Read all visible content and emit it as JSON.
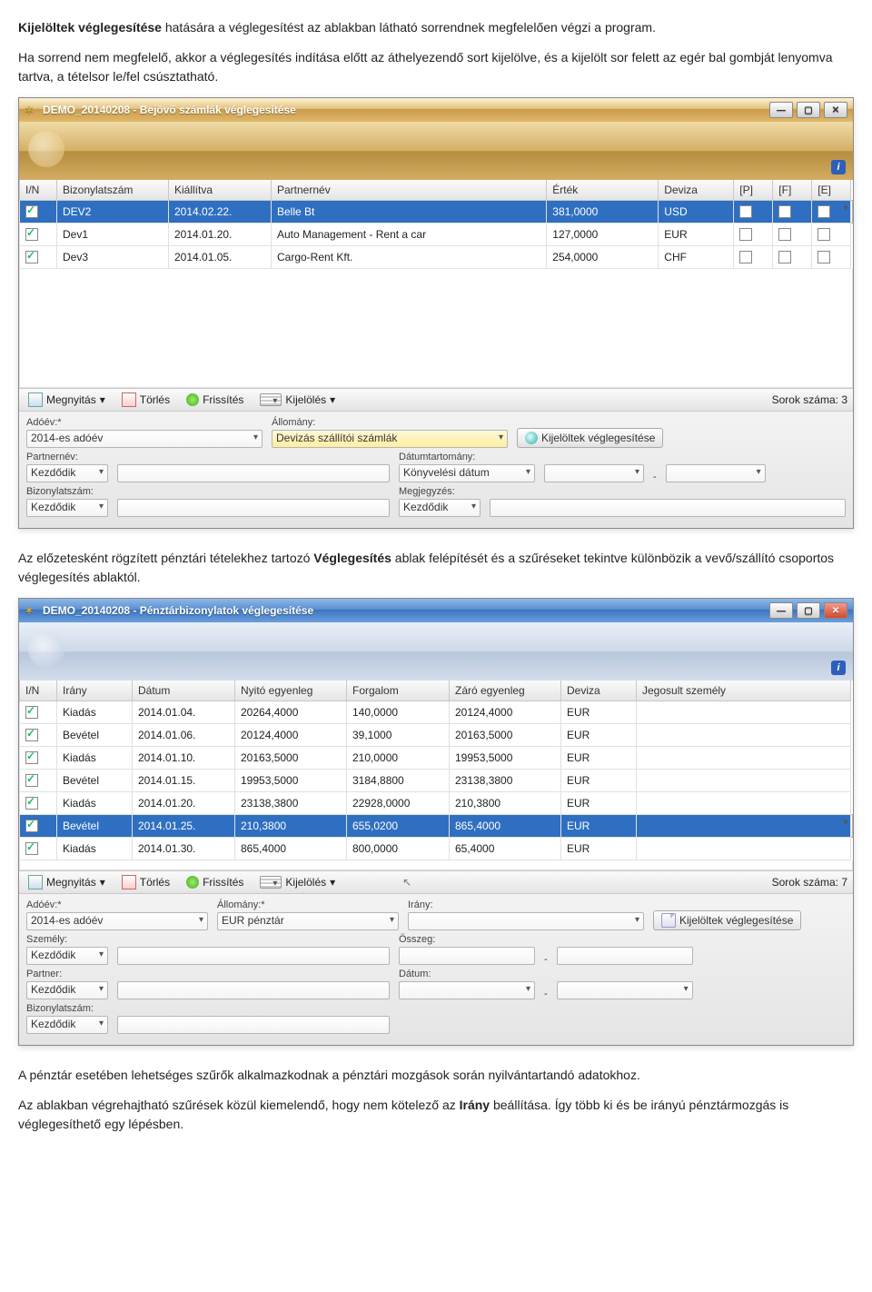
{
  "para1_a": "Kijelöltek véglegesítése",
  "para1_b": " hatására a véglegesítést az ablakban látható sorrendnek megfelelően végzi a program.",
  "para2": "Ha sorrend nem megfelelő, akkor a véglegesítés indítása előtt az áthelyezendő sort kijelölve, és a kijelölt sor felett az egér bal gombját lenyomva tartva, a tételsor le/fel csúsztatható.",
  "para3_a": "Az előzetesként rögzített pénztári tételekhez tartozó ",
  "para3_b": "Véglegesítés",
  "para3_c": " ablak felépítését és a szűréseket tekintve különbözik a vevő/szállító csoportos véglegesítés ablaktól.",
  "para4": "A pénztár esetében lehetséges szűrők alkalmazkodnak a pénztári mozgások során nyilvántartandó adatokhoz.",
  "para5_a": "Az ablakban végrehajtható szűrések közül kiemelendő, hogy nem kötelező az ",
  "para5_b": "Irány",
  "para5_c": " beállítása. Így több ki és be irányú pénztármozgás is véglegesíthető egy lépésben.",
  "w1": {
    "title": "DEMO_20140208 - Bejövő számlák véglegesítése",
    "cols": [
      "I/N",
      "Bizonylatszám",
      "Kiállítva",
      "Partnernév",
      "Érték",
      "Deviza",
      "[P]",
      "[F]",
      "[E]"
    ],
    "rows": [
      {
        "sel": true,
        "c": [
          "DEV2",
          "2014.02.22.",
          "Belle Bt",
          "381,0000",
          "USD"
        ]
      },
      {
        "sel": false,
        "c": [
          "Dev1",
          "2014.01.20.",
          "Auto Management - Rent a car",
          "127,0000",
          "EUR"
        ]
      },
      {
        "sel": false,
        "c": [
          "Dev3",
          "2014.01.05.",
          "Cargo-Rent Kft.",
          "254,0000",
          "CHF"
        ]
      }
    ],
    "toolbar": {
      "open": "Megnyitás",
      "del": "Törlés",
      "ref": "Frissítés",
      "sel": "Kijelölés",
      "rows": "Sorok száma:",
      "rowsn": "3"
    },
    "filters": {
      "adoev_l": "Adóév:*",
      "adoev_v": "2014-es adóév",
      "allomany_l": "Állomány:",
      "allomany_v": "Devizás szállítói számlák",
      "finalize": "Kijelöltek véglegesítése",
      "partner_l": "Partnernév:",
      "partner_m": "Kezdődik",
      "datumt_l": "Dátumtartomány:",
      "datumt_v": "Könyvelési dátum",
      "dash": "-",
      "biz_l": "Bizonylatszám:",
      "biz_m": "Kezdődik",
      "megj_l": "Megjegyzés:",
      "megj_m": "Kezdődik"
    }
  },
  "w2": {
    "title": "DEMO_20140208 - Pénztárbizonylatok véglegesítése",
    "cols": [
      "I/N",
      "Irány",
      "Dátum",
      "Nyitó egyenleg",
      "Forgalom",
      "Záró egyenleg",
      "Deviza",
      "Jegosult személy"
    ],
    "rows": [
      {
        "sel": false,
        "c": [
          "Kiadás",
          "2014.01.04.",
          "20264,4000",
          "140,0000",
          "20124,4000",
          "EUR",
          ""
        ]
      },
      {
        "sel": false,
        "c": [
          "Bevétel",
          "2014.01.06.",
          "20124,4000",
          "39,1000",
          "20163,5000",
          "EUR",
          ""
        ]
      },
      {
        "sel": false,
        "c": [
          "Kiadás",
          "2014.01.10.",
          "20163,5000",
          "210,0000",
          "19953,5000",
          "EUR",
          ""
        ]
      },
      {
        "sel": false,
        "c": [
          "Bevétel",
          "2014.01.15.",
          "19953,5000",
          "3184,8800",
          "23138,3800",
          "EUR",
          ""
        ]
      },
      {
        "sel": false,
        "c": [
          "Kiadás",
          "2014.01.20.",
          "23138,3800",
          "22928,0000",
          "210,3800",
          "EUR",
          ""
        ]
      },
      {
        "sel": true,
        "c": [
          "Bevétel",
          "2014.01.25.",
          "210,3800",
          "655,0200",
          "865,4000",
          "EUR",
          ""
        ]
      },
      {
        "sel": false,
        "c": [
          "Kiadás",
          "2014.01.30.",
          "865,4000",
          "800,0000",
          "65,4000",
          "EUR",
          ""
        ]
      }
    ],
    "toolbar": {
      "open": "Megnyitás",
      "del": "Törlés",
      "ref": "Frissítés",
      "sel": "Kijelölés",
      "rows": "Sorok száma:",
      "rowsn": "7"
    },
    "filters": {
      "adoev_l": "Adóév:*",
      "adoev_v": "2014-es adóév",
      "allomany_l": "Állomány:*",
      "allomany_v": "EUR pénztár",
      "irany_l": "Irány:",
      "irany_v": "",
      "finalize": "Kijelöltek véglegesítése",
      "szemely_l": "Személy:",
      "szemely_m": "Kezdődik",
      "osszeg_l": "Összeg:",
      "dash": "-",
      "partner_l": "Partner:",
      "partner_m": "Kezdődik",
      "datum_l": "Dátum:",
      "biz_l": "Bizonylatszám:",
      "biz_m": "Kezdődik"
    }
  },
  "info_i": "i"
}
